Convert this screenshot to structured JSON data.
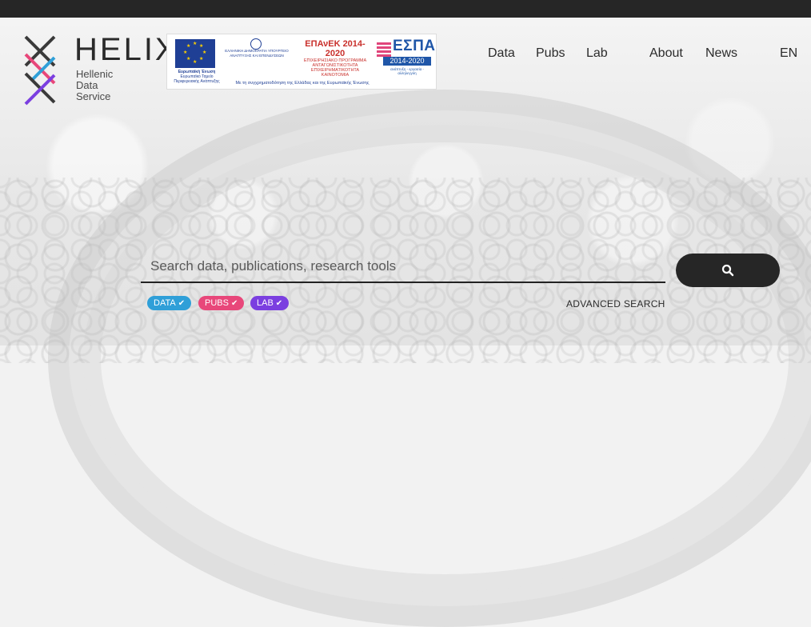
{
  "brand": {
    "name": "HELIX",
    "subtitle": [
      "Hellenic",
      "Data",
      "Service"
    ]
  },
  "banner": {
    "eu_label": "Ευρωπαϊκή Ένωση",
    "eu_sub": "Ευρωπαϊκό Ταμείο Περιφερειακής Ανάπτυξης",
    "gr_label": "ΕΛΛΗΝΙΚΗ ΔΗΜΟΚΡΑΤΙΑ ΥΠΟΥΡΓΕΙΟ ΑΝΑΠΤΥΞΗΣ ΚΑΙ ΕΠΕΝΔΥΣΕΩΝ",
    "epanek_title": "ΕΠΑνΕΚ 2014-2020",
    "epanek_sub": "ΕΠΙΧΕΙΡΗΣΙΑΚΟ ΠΡΟΓΡΑΜΜΑ ΑΝΤΑΓΩΝΙΣΤΙΚΟΤΗΤΑ ΕΠΙΧΕΙΡΗΜΑΤΙΚΟΤΗΤΑ ΚΑΙΝΟΤΟΜΙΑ",
    "espa_title": "ΕΣΠΑ",
    "espa_years": "2014-2020",
    "espa_motto": "ανάπτυξη - εργασία - αλληλεγγύη",
    "cofund": "Με τη συγχρηματοδότηση της Ελλάδας και της Ευρωπαϊκής Ένωσης"
  },
  "nav": {
    "data": "Data",
    "pubs": "Pubs",
    "lab": "Lab",
    "about": "About",
    "news": "News",
    "lang": "EN"
  },
  "search": {
    "placeholder": "Search data, publications, research tools",
    "advanced": "ADVANCED SEARCH"
  },
  "filters": [
    {
      "label": "DATA",
      "color": "#2f9fd8"
    },
    {
      "label": "PUBS",
      "color": "#e8477a"
    },
    {
      "label": "LAB",
      "color": "#7b3fe0"
    }
  ],
  "colors": {
    "topbar": "#262626",
    "search_button": "#262626"
  }
}
